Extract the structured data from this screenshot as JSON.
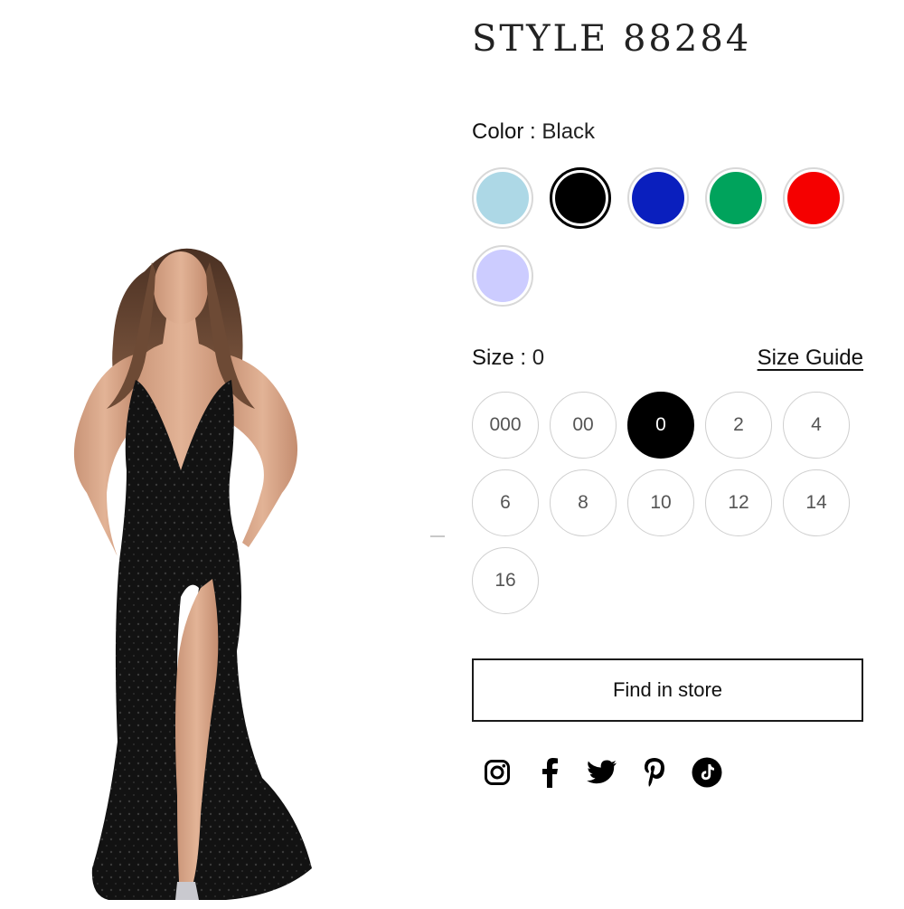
{
  "product": {
    "title": "STYLE 88284",
    "color_label": "Color : ",
    "selected_color": "Black",
    "size_label": "Size : ",
    "selected_size": "0",
    "size_guide_label": "Size Guide",
    "find_in_store_label": "Find in store"
  },
  "colors": [
    {
      "name": "light-blue",
      "hex": "#ADD8E6",
      "selected": false
    },
    {
      "name": "black",
      "hex": "#000000",
      "selected": true
    },
    {
      "name": "royal-blue",
      "hex": "#0A1FBE",
      "selected": false
    },
    {
      "name": "green",
      "hex": "#00A35C",
      "selected": false
    },
    {
      "name": "red",
      "hex": "#F50000",
      "selected": false
    },
    {
      "name": "lilac",
      "hex": "#CCCCFF",
      "selected": false
    }
  ],
  "sizes": [
    {
      "label": "000",
      "selected": false
    },
    {
      "label": "00",
      "selected": false
    },
    {
      "label": "0",
      "selected": true
    },
    {
      "label": "2",
      "selected": false
    },
    {
      "label": "4",
      "selected": false
    },
    {
      "label": "6",
      "selected": false
    },
    {
      "label": "8",
      "selected": false
    },
    {
      "label": "10",
      "selected": false
    },
    {
      "label": "12",
      "selected": false
    },
    {
      "label": "14",
      "selected": false
    },
    {
      "label": "16",
      "selected": false
    }
  ],
  "social": [
    "instagram-icon",
    "facebook-icon",
    "twitter-icon",
    "pinterest-icon",
    "tiktok-icon"
  ]
}
